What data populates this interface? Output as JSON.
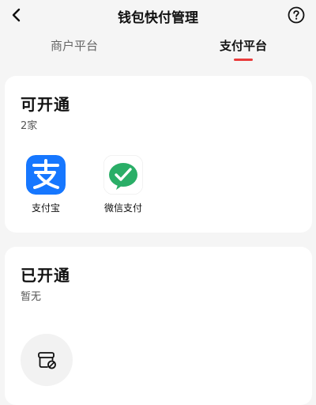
{
  "header": {
    "title": "钱包快付管理",
    "back_icon": "chevron-left-icon",
    "help_icon": "question-circle-icon"
  },
  "tabs": [
    {
      "label": "商户平台",
      "active": false
    },
    {
      "label": "支付平台",
      "active": true
    }
  ],
  "accent_color": "#e93b3b",
  "available": {
    "title": "可开通",
    "count": "2家",
    "items": [
      {
        "label": "支付宝",
        "icon": "alipay-icon",
        "color": "#1677ff"
      },
      {
        "label": "微信支付",
        "icon": "wechat-pay-icon",
        "color": "#2aae67"
      }
    ]
  },
  "opened": {
    "title": "已开通",
    "count": "暂无",
    "empty_icon": "empty-store-icon"
  }
}
